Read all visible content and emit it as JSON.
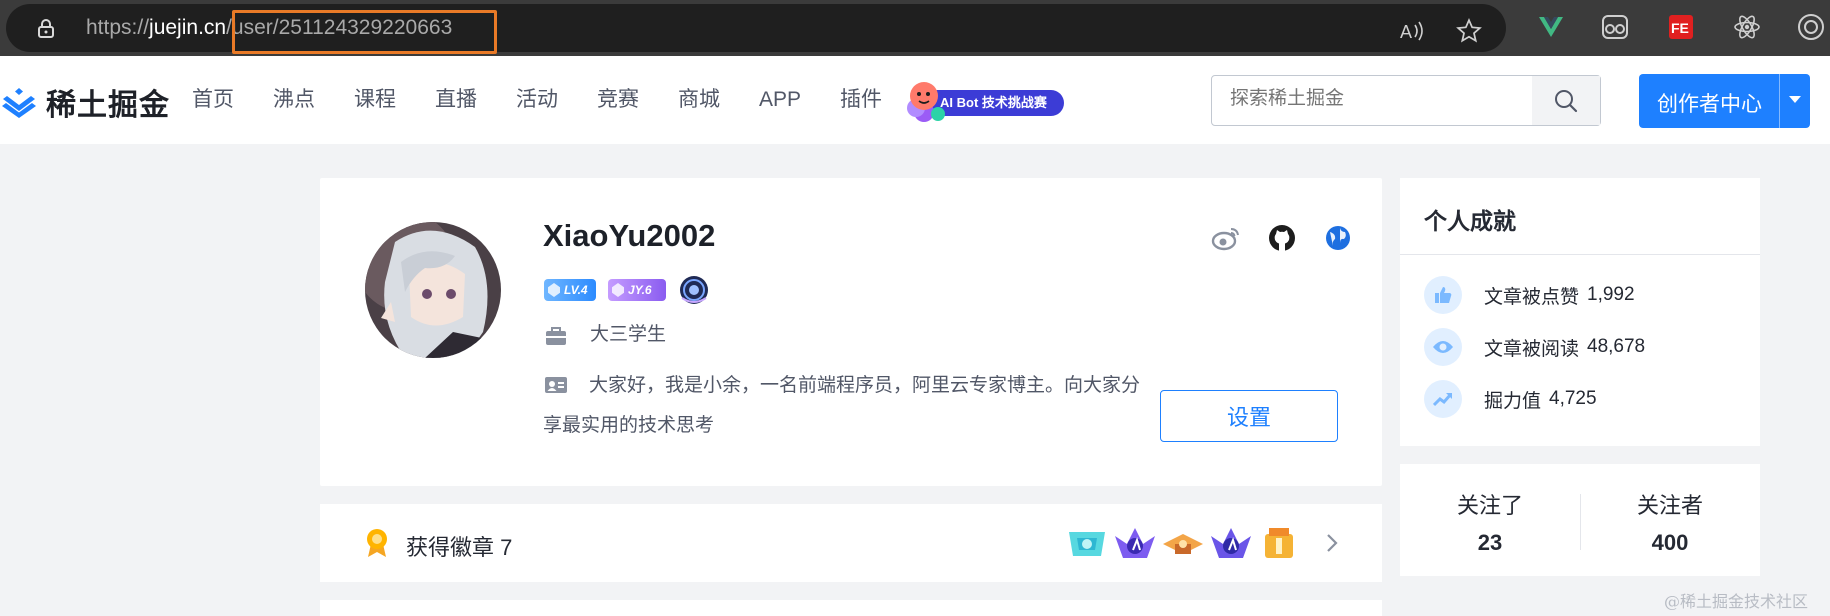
{
  "browser": {
    "url_prefix": "https://",
    "url_host": "juejin.cn",
    "url_path": "/user/251124329220663",
    "icons": [
      "lock-icon",
      "read-aloud-icon",
      "favorite-star-icon",
      "vue-devtools-icon",
      "reader-icon",
      "fe-extension-icon",
      "react-devtools-icon",
      "copilot-icon"
    ],
    "fe_label": "FE"
  },
  "header": {
    "logo_text": "稀土掘金",
    "nav": [
      "首页",
      "沸点",
      "课程",
      "直播",
      "活动",
      "竞赛",
      "商城",
      "APP",
      "插件"
    ],
    "ai_badge_label": "AI Bot 技术挑战赛",
    "search_placeholder": "探索稀土掘金",
    "creator_label": "创作者中心",
    "brand_color": "#1e80ff"
  },
  "profile": {
    "username": "XiaoYu2002",
    "level_badge": "LV.4",
    "jy_badge": "JY.6",
    "position": "大三学生",
    "bio": "大家好，我是小余，一名前端程序员，阿里云专家博主。向大家分享最实用的技术思考",
    "settings_label": "设置"
  },
  "badges": {
    "title": "获得徽章 7",
    "count_shown": 5
  },
  "achievements": {
    "title": "个人成就",
    "items": [
      {
        "label": "文章被点赞",
        "value": "1,992",
        "icon": "thumbs-up-icon"
      },
      {
        "label": "文章被阅读",
        "value": "48,678",
        "icon": "eye-icon"
      },
      {
        "label": "掘力值",
        "value": "4,725",
        "icon": "trend-up-icon"
      }
    ]
  },
  "follow": {
    "following_label": "关注了",
    "following_count": "23",
    "followers_label": "关注者",
    "followers_count": "400"
  },
  "watermark": "@稀土掘金技术社区"
}
